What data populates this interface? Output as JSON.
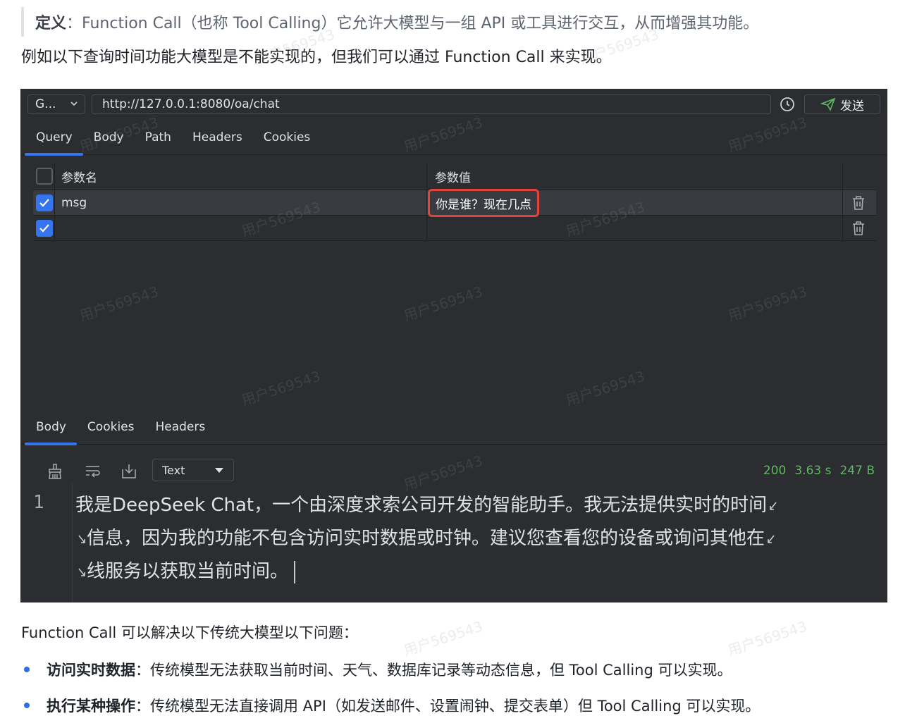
{
  "article": {
    "def_label": "定义",
    "def_text": "：Function Call（也称 Tool Calling）它允许大模型与一组 API 或工具进行交互，从而增强其功能。",
    "intro": "例如以下查询时间功能大模型是不能实现的，但我们可以通过 Function Call 来实现。",
    "problems_intro": "Function Call 可以解决以下传统大模型以下问题：",
    "bullets": [
      {
        "title": "访问实时数据",
        "text": "：传统模型无法获取当前时间、天气、数据库记录等动态信息，但 Tool Calling 可以实现。"
      },
      {
        "title": "执行某种操作",
        "text": "：传统模型无法直接调用 API（如发送邮件、设置闹钟、提交表单）但 Tool Calling 可以实现。"
      }
    ]
  },
  "app": {
    "method": "G...",
    "url": "http://127.0.0.1:8080/oa/chat",
    "send_label": "发送",
    "request_tabs": [
      "Query",
      "Body",
      "Path",
      "Headers",
      "Cookies"
    ],
    "params": {
      "header_name": "参数名",
      "header_value": "参数值",
      "rows": [
        {
          "checked": true,
          "name": "msg",
          "value": "你是谁？现在几点"
        },
        {
          "checked": true,
          "name": "",
          "value": ""
        }
      ]
    },
    "response_tabs": [
      "Body",
      "Cookies",
      "Headers"
    ],
    "format": "Text",
    "status": {
      "code": "200",
      "time": "3.63 s",
      "size": "247 B"
    },
    "response": {
      "line_number": "1",
      "lines": [
        "我是DeepSeek Chat，一个由深度求索公司开发的智能助手。我无法提供实时的时间",
        "信息，因为我的功能不包含访问实时数据或时钟。建议您查看您的设备或询问其他在",
        "线服务以获取当前时间。"
      ]
    }
  },
  "watermark": "用户569543"
}
